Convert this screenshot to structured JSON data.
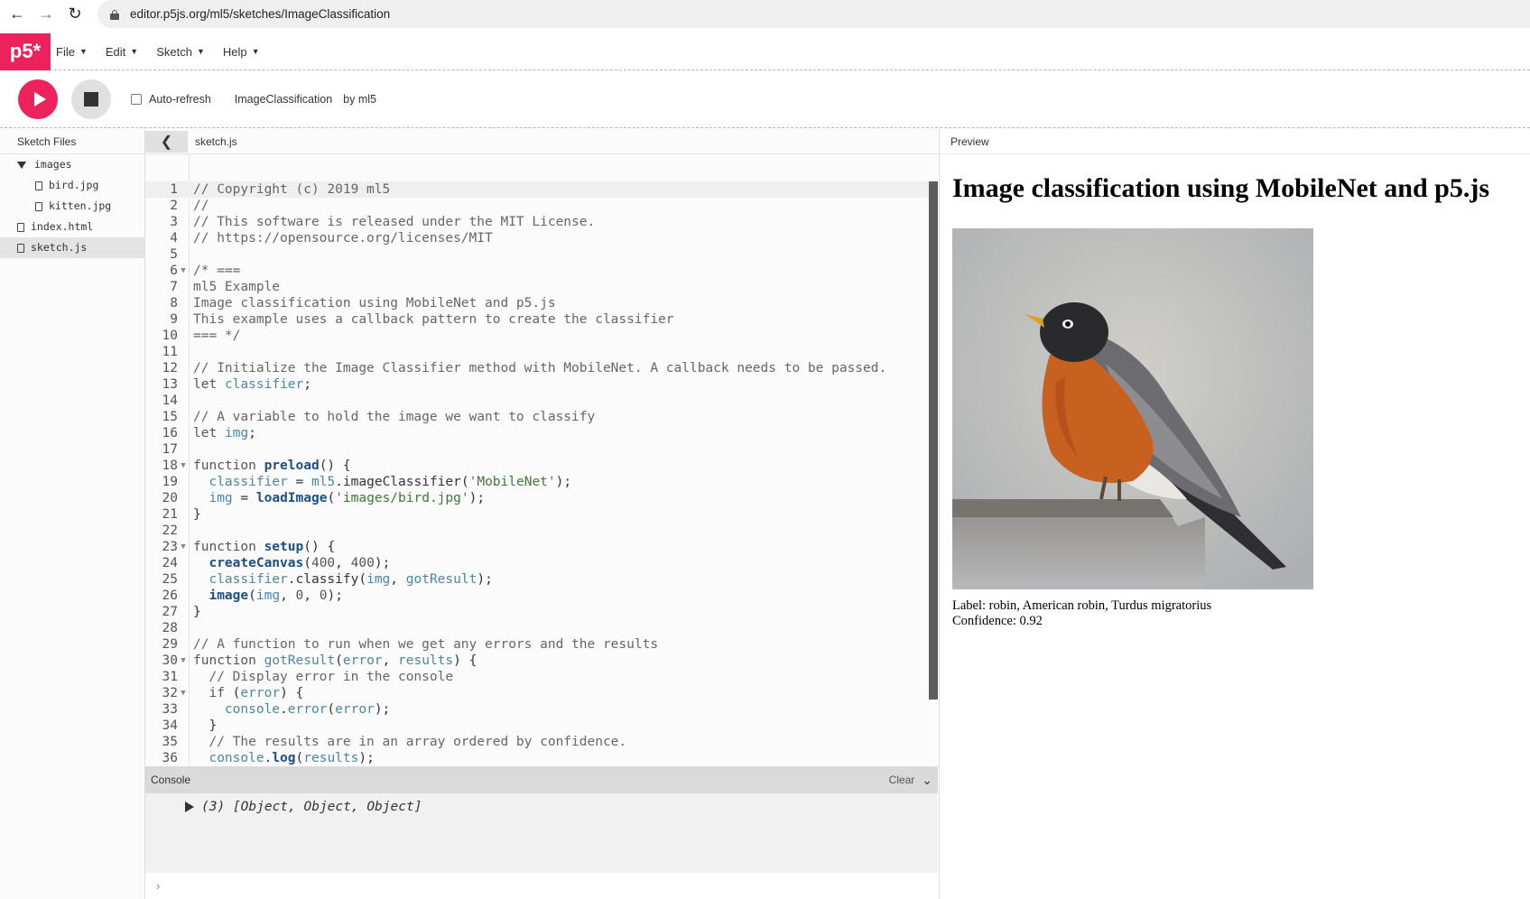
{
  "browser": {
    "url": "editor.p5js.org/ml5/sketches/ImageClassification"
  },
  "nav": {
    "logo": "p5*",
    "menus": [
      "File",
      "Edit",
      "Sketch",
      "Help"
    ]
  },
  "toolbar": {
    "auto_refresh_label": "Auto-refresh",
    "auto_refresh_checked": false,
    "sketch_name": "ImageClassification",
    "owner": "by ml5"
  },
  "sidebar": {
    "header": "Sketch Files",
    "folder": "images",
    "folder_files": [
      "bird.jpg",
      "kitten.jpg"
    ],
    "root_files": [
      "index.html",
      "sketch.js"
    ],
    "selected": "sketch.js"
  },
  "editor": {
    "tab": "sketch.js",
    "lines": [
      {
        "n": "1",
        "text": "// Copyright (c) 2019 ml5"
      },
      {
        "n": "2",
        "text": "//"
      },
      {
        "n": "3",
        "text": "// This software is released under the MIT License."
      },
      {
        "n": "4",
        "text": "// https://opensource.org/licenses/MIT"
      },
      {
        "n": "5",
        "text": ""
      },
      {
        "n": "6",
        "text": "/* ===",
        "fold": true
      },
      {
        "n": "7",
        "text": "ml5 Example"
      },
      {
        "n": "8",
        "text": "Image classification using MobileNet and p5.js"
      },
      {
        "n": "9",
        "text": "This example uses a callback pattern to create the classifier"
      },
      {
        "n": "10",
        "text": "=== */"
      },
      {
        "n": "11",
        "text": ""
      },
      {
        "n": "12",
        "text": "// Initialize the Image Classifier method with MobileNet. A callback needs to be passed."
      },
      {
        "n": "13",
        "text": "let classifier;"
      },
      {
        "n": "14",
        "text": ""
      },
      {
        "n": "15",
        "text": "// A variable to hold the image we want to classify"
      },
      {
        "n": "16",
        "text": "let img;"
      },
      {
        "n": "17",
        "text": ""
      },
      {
        "n": "18",
        "text": "function preload() {",
        "fold": true
      },
      {
        "n": "19",
        "text": "  classifier = ml5.imageClassifier('MobileNet');"
      },
      {
        "n": "20",
        "text": "  img = loadImage('images/bird.jpg');"
      },
      {
        "n": "21",
        "text": "}"
      },
      {
        "n": "22",
        "text": ""
      },
      {
        "n": "23",
        "text": "function setup() {",
        "fold": true
      },
      {
        "n": "24",
        "text": "  createCanvas(400, 400);"
      },
      {
        "n": "25",
        "text": "  classifier.classify(img, gotResult);"
      },
      {
        "n": "26",
        "text": "  image(img, 0, 0);"
      },
      {
        "n": "27",
        "text": "}"
      },
      {
        "n": "28",
        "text": ""
      },
      {
        "n": "29",
        "text": "// A function to run when we get any errors and the results"
      },
      {
        "n": "30",
        "text": "function gotResult(error, results) {",
        "fold": true
      },
      {
        "n": "31",
        "text": "  // Display error in the console"
      },
      {
        "n": "32",
        "text": "  if (error) {",
        "fold": true
      },
      {
        "n": "33",
        "text": "    console.error(error);"
      },
      {
        "n": "34",
        "text": "  }"
      },
      {
        "n": "35",
        "text": "  // The results are in an array ordered by confidence."
      },
      {
        "n": "36",
        "text": "  console.log(results);"
      }
    ]
  },
  "console": {
    "title": "Console",
    "clear_label": "Clear",
    "entry": "(3) [Object, Object, Object]",
    "prompt": "›"
  },
  "preview": {
    "header": "Preview",
    "title": "Image classification using MobileNet and p5.js",
    "label_line": "Label: robin, American robin, Turdus migratorius",
    "confidence_line": "Confidence: 0.92"
  },
  "colors": {
    "brand": "#ed225d",
    "panel_bg": "#fbfbfb",
    "console_header": "#dadada"
  }
}
